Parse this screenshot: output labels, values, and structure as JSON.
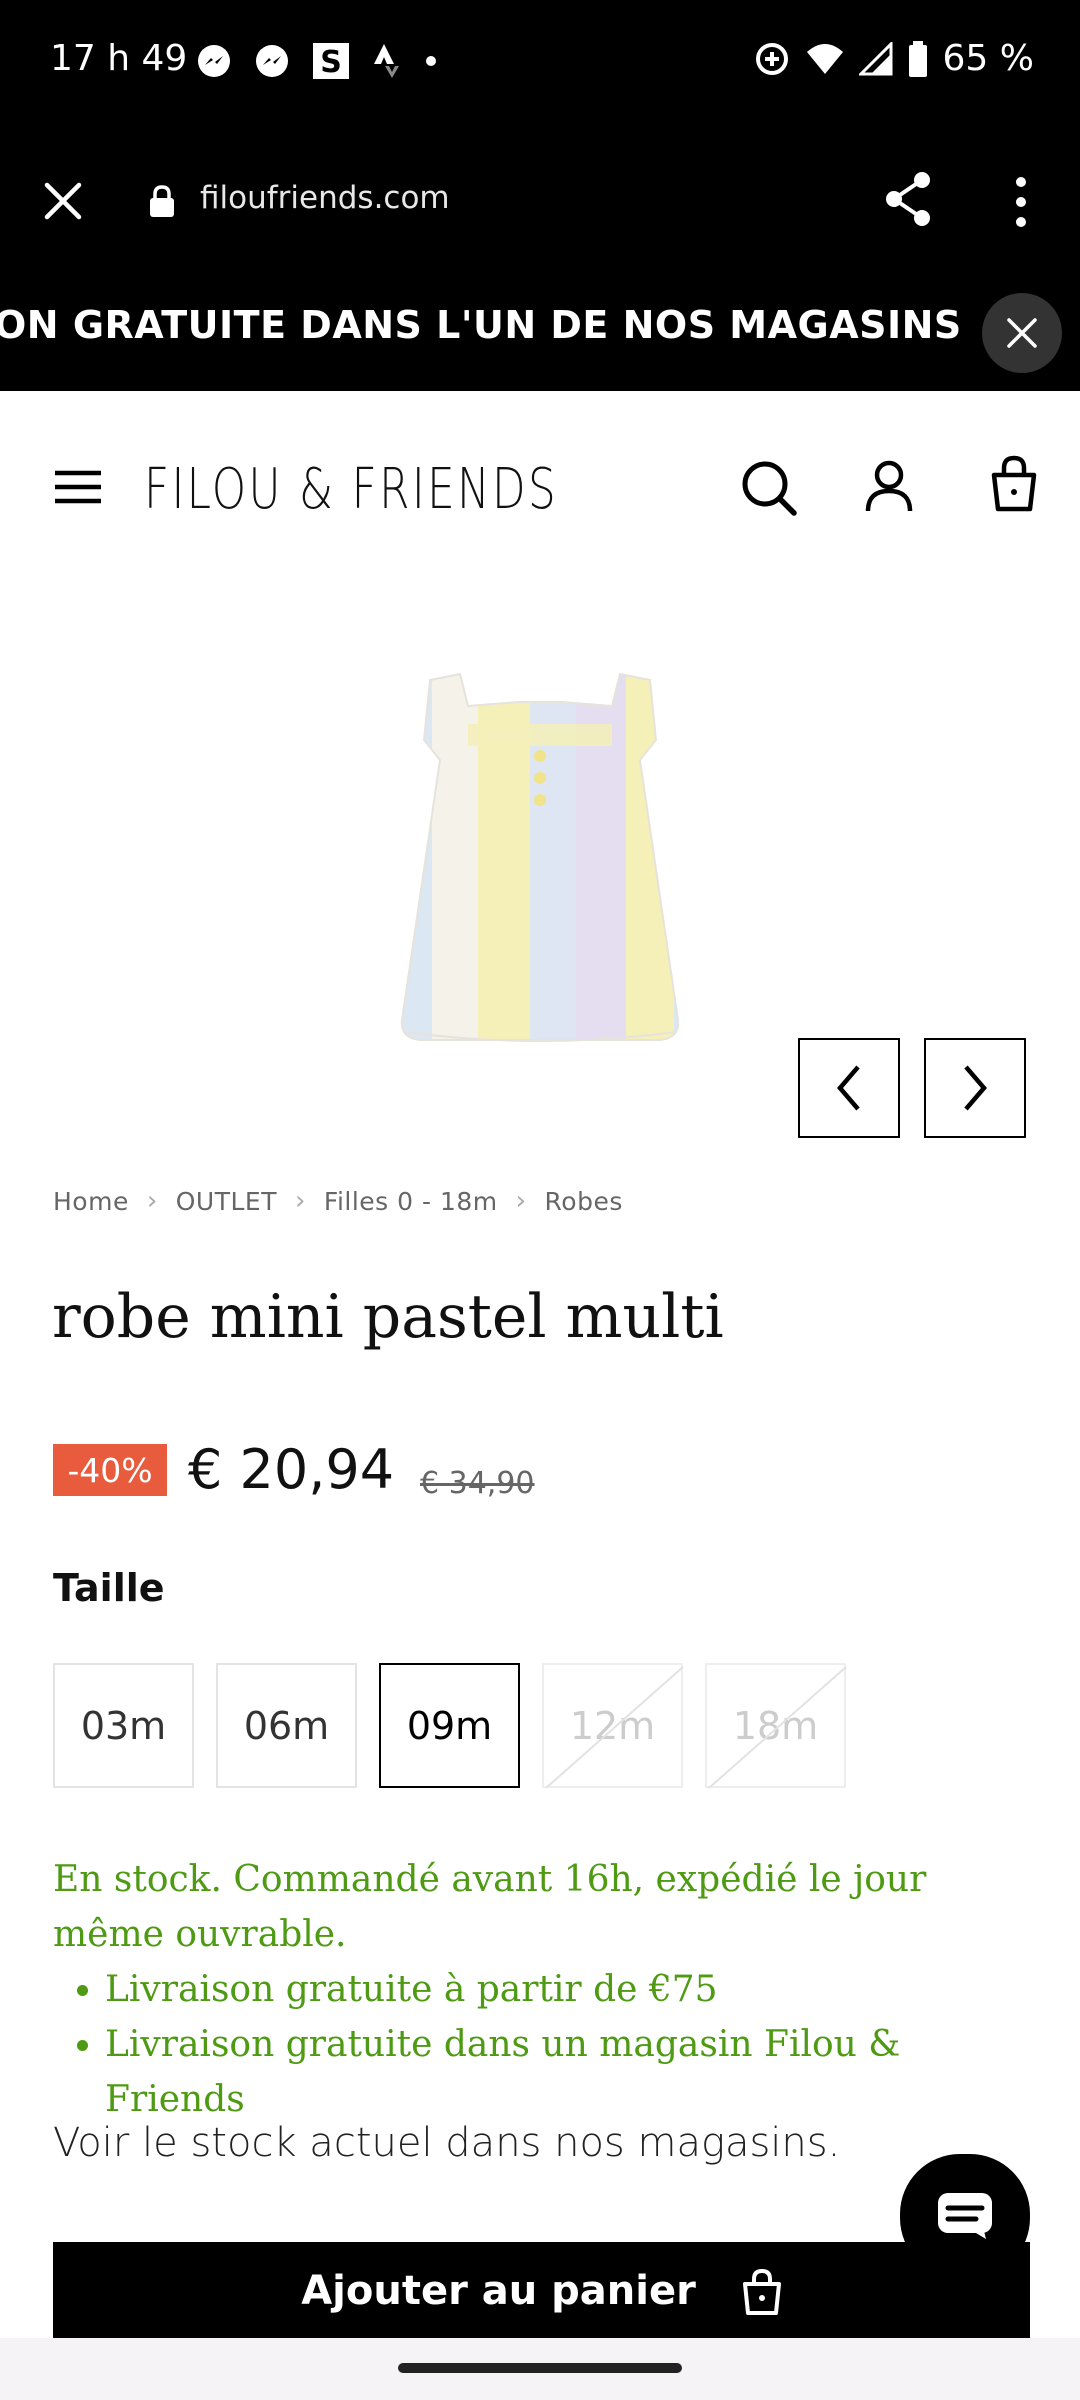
{
  "status_bar": {
    "time": "17 h 49",
    "battery": "65 %"
  },
  "browser": {
    "url": "filoufriends.com"
  },
  "announcement": {
    "text": "ON GRATUITE DANS L'UN DE NOS MAGASINS"
  },
  "header": {
    "logo": "FILOU & FRIENDS"
  },
  "breadcrumb": [
    "Home",
    "OUTLET",
    "Filles 0 - 18m",
    "Robes"
  ],
  "product": {
    "title": "robe mini pastel multi",
    "discount": "-40%",
    "price": "€ 20,94",
    "old_price": "€ 34,90",
    "size_label": "Taille",
    "sizes": [
      {
        "label": "03m",
        "state": "available"
      },
      {
        "label": "06m",
        "state": "available"
      },
      {
        "label": "09m",
        "state": "selected"
      },
      {
        "label": "12m",
        "state": "unavailable"
      },
      {
        "label": "18m",
        "state": "unavailable"
      }
    ],
    "stock_text": "En stock. Commandé avant 16h, expédié le jour même ouvrable.",
    "perks": [
      "Livraison gratuite à partir de €75",
      "Livraison gratuite dans un magasin Filou & Friends"
    ],
    "store_stock_link": "Voir le stock actuel dans nos magasins.",
    "add_to_cart": "Ajouter au panier"
  },
  "colors": {
    "accent_discount": "#e85c3d",
    "stock_green": "#4e9a12",
    "primary_black": "#000000"
  }
}
